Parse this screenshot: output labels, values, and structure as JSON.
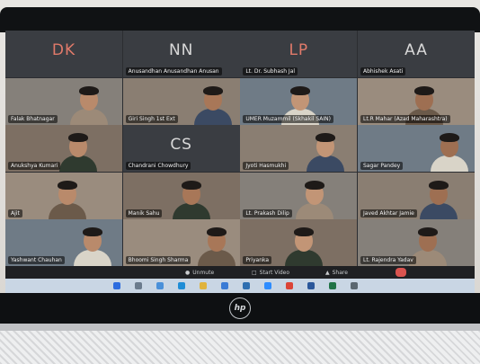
{
  "laptop": {
    "brand": "hp"
  },
  "meeting": {
    "participants": [
      {
        "initials": "DK",
        "name": "",
        "type": "avatar",
        "color": "#e07a6a"
      },
      {
        "initials": "NN",
        "name": "Anusandhan Anusandhan Anusan",
        "type": "avatar",
        "color": "#d8d8d8"
      },
      {
        "initials": "LP",
        "name": "Lt. Dr. Subhash Jal",
        "type": "avatar",
        "color": "#e07a6a"
      },
      {
        "initials": "AA",
        "name": "Abhishek Asati",
        "type": "avatar",
        "color": "#d8d8d8"
      },
      {
        "initials": "",
        "name": "Falak Bhatnagar",
        "type": "camera"
      },
      {
        "initials": "",
        "name": "Giri Singh 1st Ext",
        "type": "camera"
      },
      {
        "initials": "",
        "name": "UMER Muzammil (Skhakil SAIN)",
        "type": "camera"
      },
      {
        "initials": "",
        "name": "Lt.R Mahar (Azad Maharashtra)",
        "type": "camera"
      },
      {
        "initials": "",
        "name": "Anukshya Kumari",
        "type": "camera"
      },
      {
        "initials": "CS",
        "name": "Chandrani Chowdhury",
        "type": "avatar",
        "color": "#d8d8d8"
      },
      {
        "initials": "",
        "name": "Jyoti Hasmukhi",
        "type": "camera"
      },
      {
        "initials": "",
        "name": "Sagar Pandey",
        "type": "camera"
      },
      {
        "initials": "",
        "name": "Ajit",
        "type": "camera"
      },
      {
        "initials": "",
        "name": "Manik Sahu",
        "type": "camera"
      },
      {
        "initials": "",
        "name": "Lt. Prakash Dilip",
        "type": "camera"
      },
      {
        "initials": "",
        "name": "Javed Akhtar Jamie",
        "type": "camera"
      },
      {
        "initials": "",
        "name": "Yashwant Chauhan",
        "type": "camera"
      },
      {
        "initials": "",
        "name": "Bhoomi Singh Sharma",
        "type": "camera"
      },
      {
        "initials": "",
        "name": "Priyanka",
        "type": "camera"
      },
      {
        "initials": "",
        "name": "Lt. Rajendra Yadav",
        "type": "camera"
      }
    ]
  },
  "toolbar": {
    "mute_label": "Unmute",
    "video_label": "Start Video",
    "share_label": "Share",
    "leave_color": "#d9534f"
  },
  "taskbar": {
    "icons": [
      "windows-icon",
      "search-icon",
      "task-view-icon",
      "edge-icon",
      "file-explorer-icon",
      "store-icon",
      "mail-icon",
      "zoom-icon",
      "chrome-icon",
      "word-icon",
      "excel-icon",
      "settings-icon"
    ]
  }
}
